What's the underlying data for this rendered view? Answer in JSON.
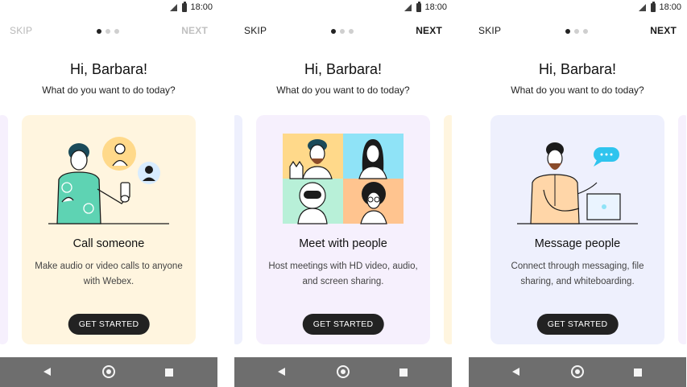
{
  "status": {
    "time": "18:00",
    "signal_icon": "signal-icon",
    "battery_icon": "battery-icon"
  },
  "nav": {
    "skip": "SKIP",
    "next": "NEXT"
  },
  "greeting": "Hi, Barbara!",
  "subtitle": "What do you want to do today?",
  "button_label": "GET STARTED",
  "screens": [
    {
      "title": "Call someone",
      "description": "Make audio or video calls to anyone with Webex.",
      "card_color": "#fff5df",
      "active_dot": 0
    },
    {
      "title": "Meet with people",
      "description": "Host meetings with HD video, audio, and screen sharing.",
      "card_color": "#f6f0fd",
      "active_dot": 0
    },
    {
      "title": "Message people",
      "description": "Connect through messaging, file sharing, and whiteboarding.",
      "card_color": "#eef0fd",
      "active_dot": 0
    }
  ],
  "colors": {
    "accent_dark": "#222222",
    "navbar": "#6e6e6e",
    "peek_call": "#fff5df",
    "peek_meet": "#f6f0fd",
    "peek_msg": "#eef0fd"
  }
}
